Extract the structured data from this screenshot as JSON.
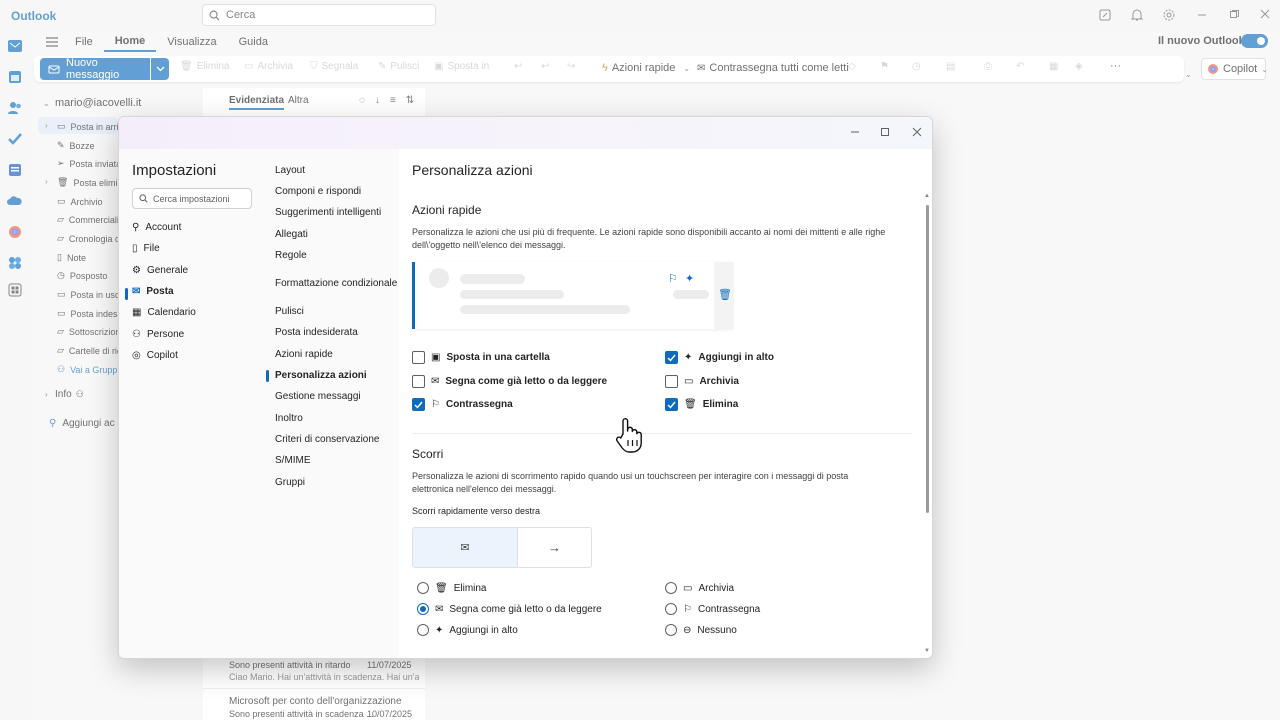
{
  "app": {
    "title": "Outlook",
    "search_placeholder": "Cerca"
  },
  "ribbon": {
    "tabs": [
      "File",
      "Home",
      "Visualizza",
      "Guida"
    ],
    "new_outlook_label": "Il nuovo Outlook",
    "new_message": "Nuovo messaggio",
    "buttons": {
      "delete": "Elimina",
      "archive": "Archivia",
      "report": "Segnala",
      "clean": "Pulisci",
      "move": "Sposta in",
      "quick_actions": "Azioni rapide",
      "mark_all_read": "Contrassegna tutti come letti",
      "copilot": "Copilot"
    }
  },
  "folders": {
    "account": "mario@iacovelli.it",
    "items": [
      "Posta in arrivo",
      "Bozze",
      "Posta inviata",
      "Posta eliminata",
      "Archivio",
      "Commerciali",
      "Cronologia d",
      "Note",
      "Posposto",
      "Posta in uscit",
      "Posta indesid",
      "Sottoscrizion",
      "Cartelle di ric",
      "Vai a Gruppi"
    ],
    "info": "Info",
    "add_account": "Aggiungi ac"
  },
  "message_list": {
    "tabs": [
      "Evidenziata",
      "Altra"
    ],
    "items": [
      {
        "line1": "Sono presenti attività in ritardo",
        "date": "11/07/2025",
        "preview": "Ciao Mario. Hai un'attività in scadenza. Hai un'attività"
      },
      {
        "sender": "Microsoft per conto dell'organizzazione",
        "line1": "Sono presenti attività in scadenza ...",
        "date": "10/07/2025"
      }
    ]
  },
  "settings": {
    "title": "Impostazioni",
    "search_placeholder": "Cerca impostazioni",
    "categories": [
      "Account",
      "File",
      "Generale",
      "Posta",
      "Calendario",
      "Persone",
      "Copilot"
    ],
    "mail_sections": [
      "Layout",
      "Componi e rispondi",
      "Suggerimenti intelligenti",
      "Allegati",
      "Regole",
      "Formattazione condizionale",
      "Pulisci",
      "Posta indesiderata",
      "Azioni rapide",
      "Personalizza azioni",
      "Gestione messaggi",
      "Inoltro",
      "Criteri di conservazione",
      "S/MIME",
      "Gruppi"
    ],
    "page_title": "Personalizza azioni",
    "quick": {
      "heading": "Azioni rapide",
      "description": "Personalizza le azioni che usi più di frequente. Le azioni rapide sono disponibili accanto ai nomi dei mittenti e alle righe dell\\'oggetto nell\\'elenco dei messaggi.",
      "options": [
        {
          "label": "Sposta in una cartella",
          "checked": false
        },
        {
          "label": "Segna come già letto o da leggere",
          "checked": false
        },
        {
          "label": "Contrassegna",
          "checked": true
        },
        {
          "label": "Aggiungi in alto",
          "checked": true
        },
        {
          "label": "Archivia",
          "checked": false
        },
        {
          "label": "Elimina",
          "checked": true
        }
      ]
    },
    "swipe": {
      "heading": "Scorri",
      "description": "Personalizza le azioni di scorrimento rapido quando usi un touchscreen per interagire con i messaggi di posta elettronica nell'elenco dei messaggi.",
      "right_label": "Scorri rapidamente verso destra",
      "options": [
        {
          "label": "Elimina",
          "selected": false
        },
        {
          "label": "Segna come già letto o da leggere",
          "selected": true
        },
        {
          "label": "Aggiungi in alto",
          "selected": false
        },
        {
          "label": "Archivia",
          "selected": false
        },
        {
          "label": "Contrassegna",
          "selected": false
        },
        {
          "label": "Nessuno",
          "selected": false
        }
      ]
    }
  },
  "colors": {
    "accent": "#0f6cbd"
  }
}
